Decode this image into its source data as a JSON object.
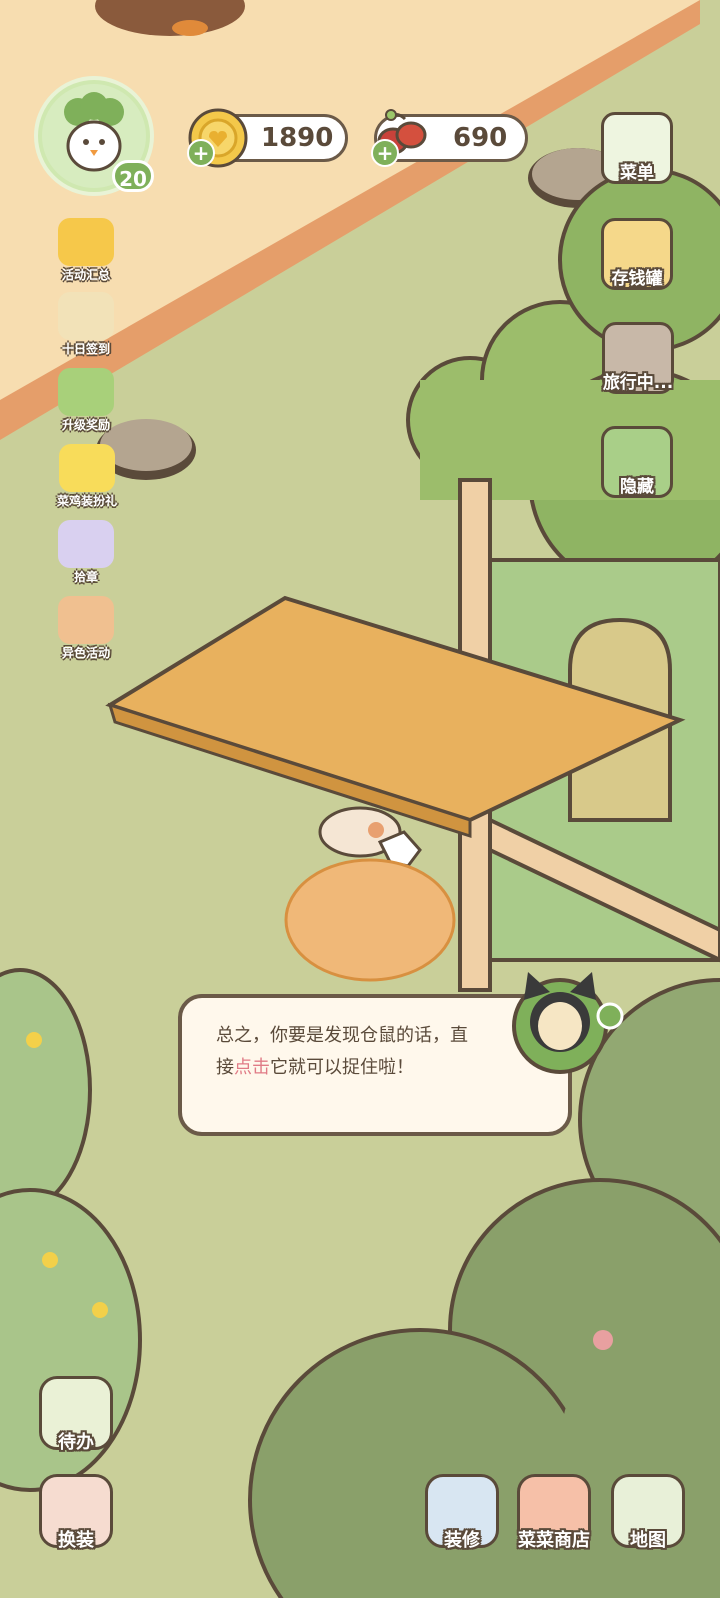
{
  "player": {
    "level": "20"
  },
  "currency": {
    "coins": "1890",
    "food": "690"
  },
  "left_menu": [
    {
      "label": "活动汇总",
      "icon": "event-summary-icon"
    },
    {
      "label": "十日签到",
      "icon": "ten-day-checkin-icon"
    },
    {
      "label": "升级奖励",
      "icon": "level-reward-icon"
    },
    {
      "label": "菜鸡装扮礼",
      "icon": "duck-outfit-icon"
    },
    {
      "label": "拾章",
      "icon": "badge-collect-icon"
    },
    {
      "label": "异色活动",
      "icon": "color-event-icon"
    }
  ],
  "right_menu": [
    {
      "label": "菜单",
      "icon": "menu-icon"
    },
    {
      "label": "存钱罐",
      "icon": "piggy-bank-icon"
    },
    {
      "label": "旅行中...",
      "icon": "camera-icon"
    },
    {
      "label": "隐藏",
      "icon": "hide-icon"
    }
  ],
  "dialog": {
    "text_before": "总之，你要是发现仓鼠的话，直接",
    "highlight": "点击",
    "text_after": "它就可以捉住啦！"
  },
  "bottom_left": [
    {
      "label": "待办",
      "icon": "todo-icon"
    },
    {
      "label": "换装",
      "icon": "dress-up-icon"
    }
  ],
  "bottom_right": [
    {
      "label": "装修",
      "icon": "decorate-icon"
    },
    {
      "label": "菜菜商店",
      "icon": "shop-icon"
    },
    {
      "label": "地图",
      "icon": "map-icon"
    }
  ],
  "colors": {
    "outline": "#5a4a3a",
    "accent_green": "#7fb05a",
    "highlight_pink": "#e07b86",
    "floor": "#c9cf99",
    "wall": "#f7ddb0"
  }
}
